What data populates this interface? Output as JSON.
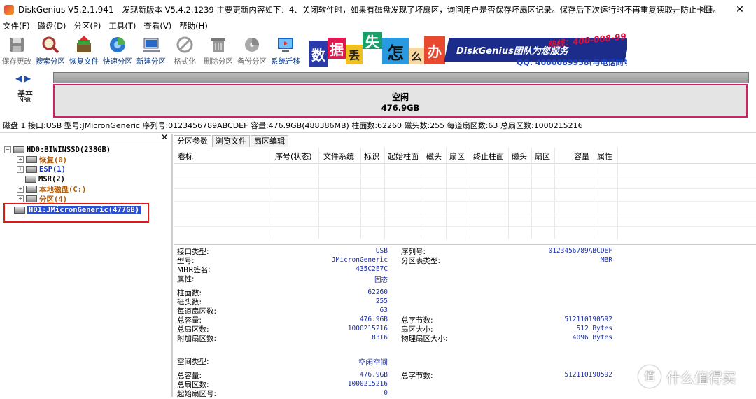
{
  "titlebar": {
    "app_title": "DiskGenius V5.2.1.941",
    "notice": "发现新版本 V5.4.2.1239 主要更新内容如下：4、关闭软件时，如果有磁盘发现了坏扇区，询问用户是否保存坏扇区记录。保存后下次运行时不再重复读取，防止卡顿。",
    "minimize": "—",
    "maximize": "☐",
    "close": "✕"
  },
  "menu": [
    "文件(F)",
    "磁盘(D)",
    "分区(P)",
    "工具(T)",
    "查看(V)",
    "帮助(H)"
  ],
  "toolbar": [
    {
      "label": "保存更改",
      "icon": "save-icon",
      "enabled": false
    },
    {
      "label": "搜索分区",
      "icon": "search-partition-icon",
      "enabled": true
    },
    {
      "label": "恢复文件",
      "icon": "recover-file-icon",
      "enabled": true
    },
    {
      "label": "快速分区",
      "icon": "quick-partition-icon",
      "enabled": true
    },
    {
      "label": "新建分区",
      "icon": "new-partition-icon",
      "enabled": true
    },
    {
      "label": "格式化",
      "icon": "format-icon",
      "enabled": false
    },
    {
      "label": "删除分区",
      "icon": "delete-partition-icon",
      "enabled": false
    },
    {
      "label": "备份分区",
      "icon": "backup-partition-icon",
      "enabled": false
    },
    {
      "label": "系统迁移",
      "icon": "system-migrate-icon",
      "enabled": true
    }
  ],
  "banner": {
    "chars": [
      "数",
      "据",
      "丢",
      "失",
      "怎",
      "么",
      "办"
    ],
    "brand": "DiskGenius团队为您服务",
    "phone": "热线：400-008-9958",
    "qq": "QQ: 4000089958(与电话同号)"
  },
  "diskmap": {
    "arrows": "◀ ▶",
    "label_line1": "基本",
    "label_line2": "MBR",
    "free_name": "空闲",
    "free_size": "476.9GB"
  },
  "disk_info": "磁盘 1 接口:USB  型号:JMicronGeneric  序列号:0123456789ABCDEF  容量:476.9GB(488386MB)  柱面数:62260  磁头数:255  每道扇区数:63  总扇区数:1000215216",
  "tree": {
    "close": "✕",
    "items": [
      {
        "label": "HD0:BIWINSSD(238GB)",
        "level": 0,
        "expander": "−",
        "style": "normal"
      },
      {
        "label": "恢复(0)",
        "level": 1,
        "expander": "+",
        "style": "orange"
      },
      {
        "label": "ESP(1)",
        "level": 1,
        "expander": "+",
        "style": "blue"
      },
      {
        "label": "MSR(2)",
        "level": 1,
        "expander": "",
        "style": "normal"
      },
      {
        "label": "本地磁盘(C:)",
        "level": 1,
        "expander": "+",
        "style": "orange"
      },
      {
        "label": "分区(4)",
        "level": 1,
        "expander": "+",
        "style": "orange"
      },
      {
        "label": "HD1:JMicronGeneric(477GB)",
        "level": 0,
        "expander": "",
        "style": "selected"
      }
    ]
  },
  "tabs": [
    "分区参数",
    "浏览文件",
    "扇区编辑"
  ],
  "columns": [
    "卷标",
    "序号(状态)",
    "文件系统",
    "标识",
    "起始柱面",
    "磁头",
    "扇区",
    "终止柱面",
    "磁头",
    "扇区",
    "容量",
    "属性"
  ],
  "props": {
    "left": [
      {
        "label": "接口类型:",
        "value": "USB"
      },
      {
        "label": "型号:",
        "value": "JMicronGeneric"
      },
      {
        "label": "MBR签名:",
        "value": "435C2E7C"
      },
      {
        "label": "属性:",
        "value": "固态"
      },
      {
        "label": "柱面数:",
        "value": "62260"
      },
      {
        "label": "磁头数:",
        "value": "255"
      },
      {
        "label": "每道扇区数:",
        "value": "63"
      },
      {
        "label": "总容量:",
        "value": "476.9GB"
      },
      {
        "label": "总扇区数:",
        "value": "1000215216"
      },
      {
        "label": "附加扇区数:",
        "value": "8316"
      }
    ],
    "right": [
      {
        "label": "序列号:",
        "value": "0123456789ABCDEF"
      },
      {
        "label": "分区表类型:",
        "value": "MBR"
      },
      {
        "label": "总字节数:",
        "value": "512110190592"
      },
      {
        "label": "扇区大小:",
        "value": "512 Bytes"
      },
      {
        "label": "物理扇区大小:",
        "value": "4096 Bytes"
      }
    ],
    "space": [
      {
        "label": "空间类型:",
        "value": "空闲空间"
      },
      {
        "label": "总容量:",
        "value": "476.9GB"
      },
      {
        "label": "总扇区数:",
        "value": "1000215216"
      },
      {
        "label": "起始扇区号:",
        "value": "0"
      }
    ],
    "space_right": [
      {
        "label": "总字节数:",
        "value": "512110190592"
      }
    ]
  },
  "watermark": {
    "logo": "值",
    "text": "什么值得买"
  }
}
